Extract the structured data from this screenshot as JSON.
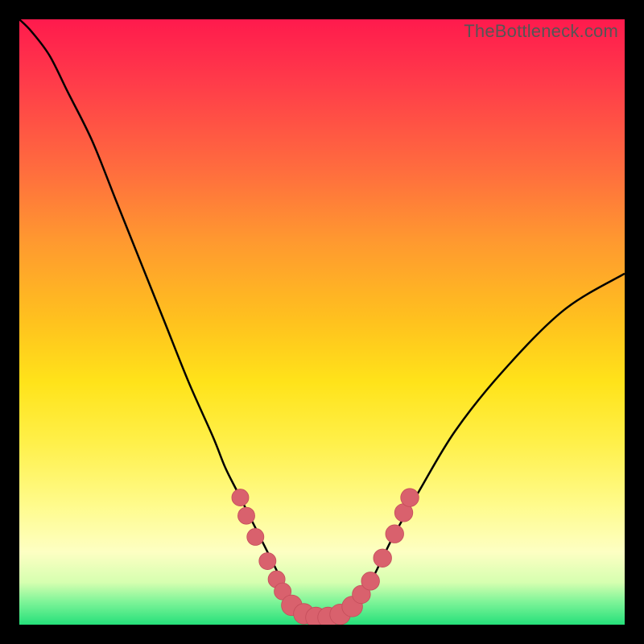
{
  "watermark": "TheBottleneck.com",
  "colors": {
    "frame": "#000000",
    "curve_stroke": "#000000",
    "marker_fill": "#d9616d",
    "marker_stroke": "#c44d5a"
  },
  "chart_data": {
    "type": "line",
    "title": "",
    "xlabel": "",
    "ylabel": "",
    "xlim": [
      0,
      100
    ],
    "ylim": [
      0,
      100
    ],
    "series": [
      {
        "name": "bottleneck-curve",
        "x": [
          0,
          2,
          5,
          8,
          12,
          16,
          20,
          24,
          28,
          32,
          34,
          36,
          38,
          40,
          42,
          44,
          46,
          48,
          50,
          52,
          54,
          56,
          58,
          60,
          62,
          66,
          72,
          80,
          90,
          100
        ],
        "y": [
          100,
          98,
          94,
          88,
          80,
          70,
          60,
          50,
          40,
          31,
          26,
          22,
          18,
          14,
          10,
          6,
          3,
          1.5,
          1,
          1.2,
          2,
          4,
          7,
          11,
          15,
          22,
          32,
          42,
          52,
          58
        ]
      }
    ],
    "markers": [
      {
        "x": 36.5,
        "y": 21,
        "r": 1.4
      },
      {
        "x": 37.5,
        "y": 18,
        "r": 1.4
      },
      {
        "x": 39,
        "y": 14.5,
        "r": 1.4
      },
      {
        "x": 41,
        "y": 10.5,
        "r": 1.4
      },
      {
        "x": 42.5,
        "y": 7.5,
        "r": 1.4
      },
      {
        "x": 43.5,
        "y": 5.5,
        "r": 1.4
      },
      {
        "x": 45,
        "y": 3.2,
        "r": 1.7
      },
      {
        "x": 47,
        "y": 1.8,
        "r": 1.7
      },
      {
        "x": 49,
        "y": 1.2,
        "r": 1.7
      },
      {
        "x": 51,
        "y": 1.2,
        "r": 1.7
      },
      {
        "x": 53,
        "y": 1.7,
        "r": 1.7
      },
      {
        "x": 55,
        "y": 3.0,
        "r": 1.7
      },
      {
        "x": 56.5,
        "y": 5.0,
        "r": 1.5
      },
      {
        "x": 58,
        "y": 7.2,
        "r": 1.5
      },
      {
        "x": 60,
        "y": 11,
        "r": 1.5
      },
      {
        "x": 62,
        "y": 15,
        "r": 1.5
      },
      {
        "x": 63.5,
        "y": 18.5,
        "r": 1.5
      },
      {
        "x": 64.5,
        "y": 21,
        "r": 1.5
      }
    ]
  }
}
